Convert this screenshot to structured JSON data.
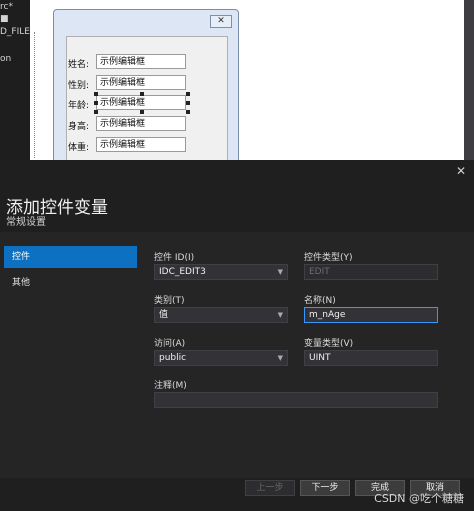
{
  "background": {
    "left_panel": [
      "rc*",
      "■",
      "D_FILEI",
      "on"
    ],
    "design_dialog": {
      "close_glyph": "✕",
      "rows": [
        {
          "label": "姓名:",
          "value": "示例编辑框"
        },
        {
          "label": "性别:",
          "value": "示例编辑框"
        },
        {
          "label": "年龄:",
          "value": "示例编辑框"
        },
        {
          "label": "身高:",
          "value": "示例编辑框"
        },
        {
          "label": "体重:",
          "value": "示例编辑框"
        }
      ]
    }
  },
  "dialog": {
    "close_glyph": "✕",
    "title": "添加控件变量",
    "subtitle": "常规设置",
    "nav": [
      {
        "label": "控件",
        "active": true
      },
      {
        "label": "其他",
        "active": false
      }
    ],
    "fields": {
      "control_id": {
        "label": "控件 ID(I)",
        "value": "IDC_EDIT3"
      },
      "control_type": {
        "label": "控件类型(Y)",
        "value": "EDIT"
      },
      "category": {
        "label": "类别(T)",
        "value": "值"
      },
      "name": {
        "label": "名称(N)",
        "value": "m_nAge"
      },
      "access": {
        "label": "访问(A)",
        "value": "public"
      },
      "var_type": {
        "label": "变量类型(V)",
        "value": "UINT"
      },
      "comment": {
        "label": "注释(M)",
        "value": ""
      }
    },
    "buttons": {
      "prev": "上一步",
      "next": "下一步",
      "finish": "完成",
      "cancel": "取消"
    },
    "watermark": "CSDN @吃个糖糖",
    "accent": "#0e70c0"
  }
}
